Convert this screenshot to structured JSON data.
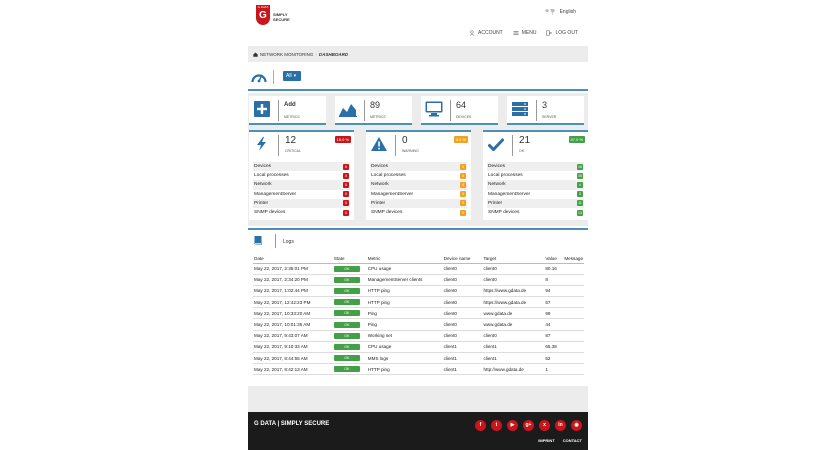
{
  "brand": {
    "tag": "G DATA",
    "line1": "SIMPLY",
    "line2": "SECURE"
  },
  "language": "English",
  "topnav": [
    {
      "label": "ACCOUNT",
      "icon": "user-icon"
    },
    {
      "label": "MENU",
      "icon": "menu-icon"
    },
    {
      "label": "LOG OUT",
      "icon": "logout-icon"
    }
  ],
  "breadcrumb": {
    "section": "NETWORK MONITORING",
    "separator": "·",
    "current": "DASHBOARD"
  },
  "filter": {
    "selected": "All",
    "arrow": "▾"
  },
  "stats": [
    {
      "value": "Add",
      "label": "METRICS",
      "icon": "add-icon"
    },
    {
      "value": "89",
      "label": "METRICS",
      "icon": "area-chart-icon"
    },
    {
      "value": "64",
      "label": "DEVICES",
      "icon": "monitor-icon"
    },
    {
      "value": "3",
      "label": "SERVER",
      "icon": "server-icon"
    }
  ],
  "cards": [
    {
      "name": "critical",
      "value": "12",
      "label": "CRITICAL",
      "pct": "15.0 %",
      "color": "#c8161d",
      "icon": "lightning-icon",
      "rows": [
        {
          "label": "Devices",
          "count": "6"
        },
        {
          "label": "Local processes",
          "count": "0"
        },
        {
          "label": "Network",
          "count": "0"
        },
        {
          "label": "ManagementServer",
          "count": "0"
        },
        {
          "label": "Printer",
          "count": "0"
        },
        {
          "label": "SNMP devices",
          "count": "0"
        }
      ]
    },
    {
      "name": "warning",
      "value": "0",
      "label": "WARNING",
      "pct": "0.0 %",
      "color": "#f0a320",
      "icon": "warning-icon",
      "rows": [
        {
          "label": "Devices",
          "count": "0"
        },
        {
          "label": "Local processes",
          "count": "0"
        },
        {
          "label": "Network",
          "count": "0"
        },
        {
          "label": "ManagementServer",
          "count": "0"
        },
        {
          "label": "Printer",
          "count": "0"
        },
        {
          "label": "SNMP devices",
          "count": "0"
        }
      ]
    },
    {
      "name": "ok",
      "value": "21",
      "label": "OK",
      "pct": "87.0 %",
      "color": "#43a046",
      "icon": "checkmark-icon",
      "rows": [
        {
          "label": "Devices",
          "count": "16"
        },
        {
          "label": "Local processes",
          "count": "35"
        },
        {
          "label": "Network",
          "count": "4"
        },
        {
          "label": "ManagementServer",
          "count": "3"
        },
        {
          "label": "Printer",
          "count": "11"
        },
        {
          "label": "SNMP devices",
          "count": "13"
        }
      ]
    }
  ],
  "logs": {
    "title": "Logs",
    "columns": [
      "Date",
      "State",
      "Metric",
      "Device name",
      "Target",
      "Value",
      "Message"
    ],
    "rows": [
      [
        "May 22, 2017, 2:35:01 PM",
        "OK",
        "CPU usage",
        "client0",
        "client0",
        "80.16",
        ""
      ],
      [
        "May 22, 2017, 2:34:20 PM",
        "OK",
        "ManagementServer clients",
        "client0",
        "client0",
        "8",
        ""
      ],
      [
        "May 22, 2017, 1:02:44 PM",
        "OK",
        "HTTP ping",
        "client0",
        "https://www.gdata.de",
        "94",
        ""
      ],
      [
        "May 22, 2017, 12:42:23 PM",
        "OK",
        "HTTP ping",
        "client0",
        "https://www.gdata.de",
        "57",
        ""
      ],
      [
        "May 22, 2017, 10:33:20 AM",
        "OK",
        "Ping",
        "client0",
        "www.gdata.de",
        "99",
        ""
      ],
      [
        "May 22, 2017, 10:01:35 AM",
        "OK",
        "Ping",
        "client0",
        "www.gdata.de",
        "44",
        ""
      ],
      [
        "May 22, 2017, 9:43:07 AM",
        "OK",
        "Working set",
        "client0",
        "client0",
        "87",
        ""
      ],
      [
        "May 22, 2017, 9:10:33 AM",
        "OK",
        "CPU usage",
        "client1",
        "client1",
        "65.38",
        ""
      ],
      [
        "May 22, 2017, 8:44:55 AM",
        "OK",
        "MMS logs",
        "client1",
        "client1",
        "52",
        ""
      ],
      [
        "May 22, 2017, 8:42:13 AM",
        "OK",
        "HTTP ping",
        "client1",
        "http://www.gdata.de",
        "1",
        ""
      ]
    ]
  },
  "footer": {
    "brand": "G DATA | SIMPLY SECURE",
    "social": [
      {
        "icon": "facebook-icon",
        "glyph": "f"
      },
      {
        "icon": "twitter-icon",
        "glyph": "t"
      },
      {
        "icon": "youtube-icon",
        "glyph": "▶"
      },
      {
        "icon": "googleplus-icon",
        "glyph": "g+"
      },
      {
        "icon": "xing-icon",
        "glyph": "x"
      },
      {
        "icon": "linkedin-icon",
        "glyph": "in"
      },
      {
        "icon": "rss-icon",
        "glyph": "◉"
      }
    ],
    "links": [
      "IMPRINT",
      "CONTACT"
    ]
  },
  "colors": {
    "accent": "#4a90b8",
    "brand_red": "#c8161d",
    "footer_bg": "#1b1b1b"
  }
}
